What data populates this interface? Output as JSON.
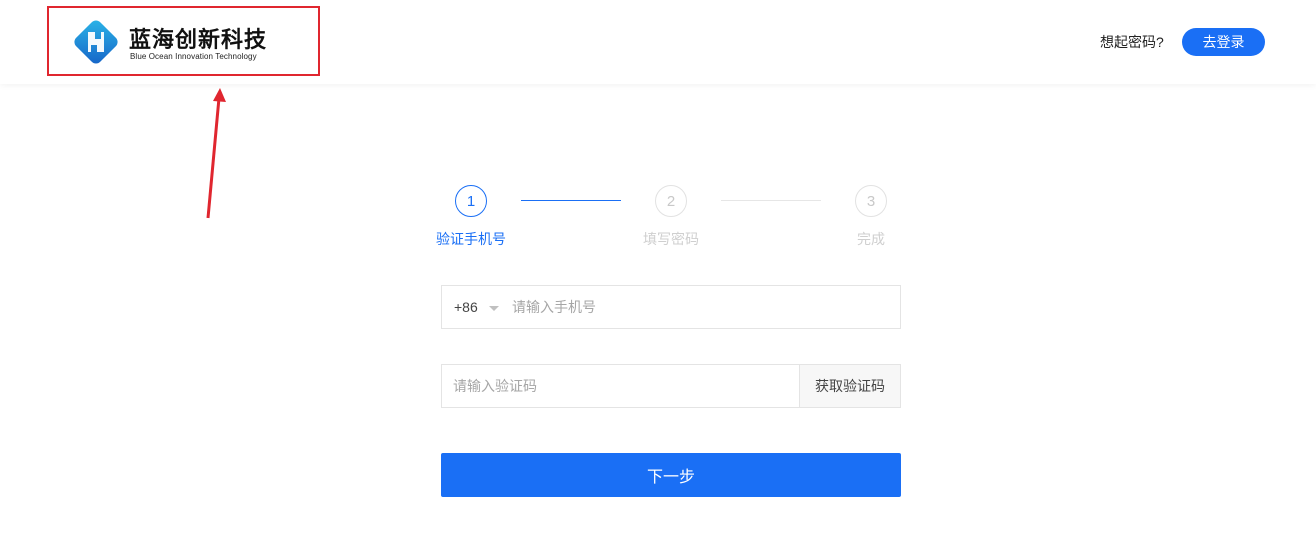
{
  "header": {
    "brand_cn": "蓝海创新科技",
    "brand_en": "Blue Ocean Innovation Technology",
    "forgot_text": "想起密码?",
    "login_label": "去登录"
  },
  "steps": [
    {
      "number": "1",
      "label": "验证手机号",
      "state": "active"
    },
    {
      "number": "2",
      "label": "填写密码",
      "state": "inactive"
    },
    {
      "number": "3",
      "label": "完成",
      "state": "inactive"
    }
  ],
  "form": {
    "country_code": "+86",
    "phone_placeholder": "请输入手机号",
    "code_placeholder": "请输入验证码",
    "get_code_label": "获取验证码",
    "next_label": "下一步"
  },
  "colors": {
    "accent": "#1a6ff5",
    "highlight_box": "#e0262f",
    "inactive": "#cfcfcf"
  },
  "icons": {
    "logo": "blue-ocean-logo-icon",
    "annotation": "red-arrow-icon",
    "dropdown": "caret-down-icon"
  }
}
